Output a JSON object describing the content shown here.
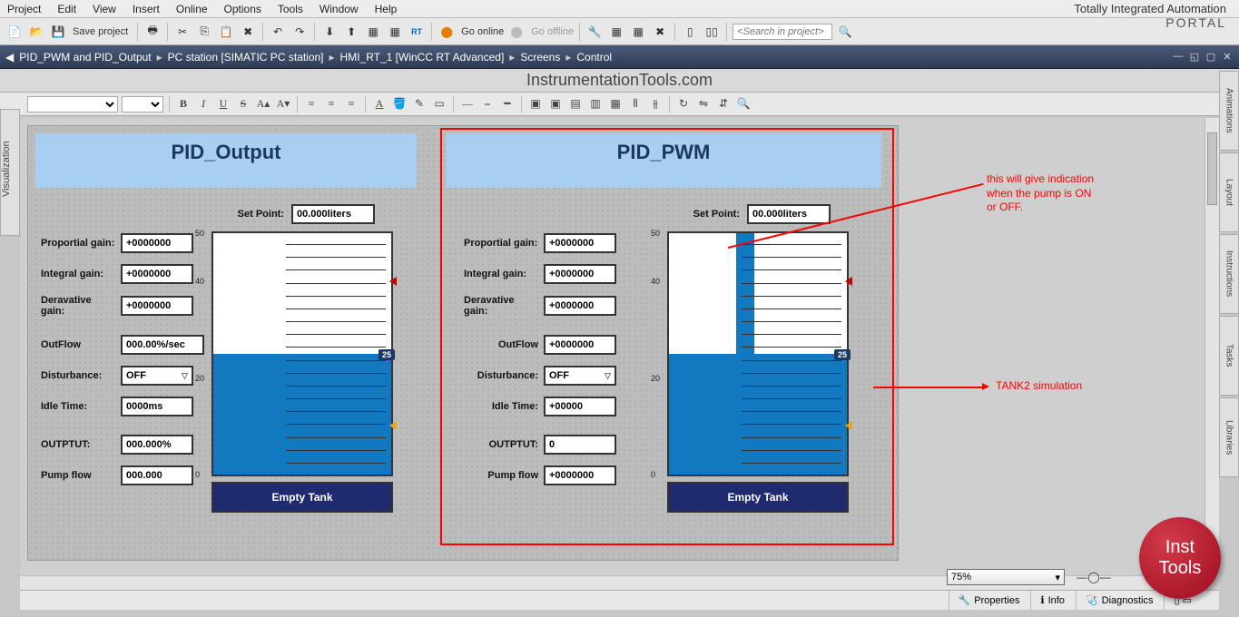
{
  "brand": {
    "line1": "Totally Integrated Automation",
    "line2": "PORTAL"
  },
  "menu": [
    "Project",
    "Edit",
    "View",
    "Insert",
    "Online",
    "Options",
    "Tools",
    "Window",
    "Help"
  ],
  "toolbar": {
    "save_label": "Save project",
    "go_online": "Go online",
    "go_offline": "Go offline",
    "search_placeholder": "<Search in project>"
  },
  "breadcrumb": [
    "PID_PWM and PID_Output",
    "PC station [SIMATIC PC station]",
    "HMI_RT_1 [WinCC RT Advanced]",
    "Screens",
    "Control"
  ],
  "watermark": "InstrumentationTools.com",
  "left_tab": "Visualization",
  "right_tabs": [
    "Animations",
    "Layout",
    "Instructions",
    "Tasks",
    "Libraries"
  ],
  "panels": {
    "output": {
      "title": "PID_Output",
      "setpoint_label": "Set Point:",
      "setpoint_value": "00.000liters",
      "rows": [
        {
          "label": "Proportial gain:",
          "value": "+0000000"
        },
        {
          "label": "Integral gain:",
          "value": "+0000000"
        },
        {
          "label": "Deravative gain:",
          "value": "+0000000"
        }
      ],
      "rows2": [
        {
          "label": "OutFlow",
          "value": "000.00%/sec"
        },
        {
          "label": "Disturbance:",
          "value": "OFF",
          "dropdown": true
        },
        {
          "label": "Idle Time:",
          "value": "0000ms"
        }
      ],
      "rows3": [
        {
          "label": "OUTPTUT:",
          "value": "000.000%"
        },
        {
          "label": "Pump flow",
          "value": "000.000"
        }
      ],
      "scale": {
        "top": "50",
        "mid": "40",
        "low": "20",
        "bottom": "0",
        "badge": "25"
      },
      "empty_btn": "Empty Tank"
    },
    "pwm": {
      "title": "PID_PWM",
      "setpoint_label": "Set Point:",
      "setpoint_value": "00.000liters",
      "rows": [
        {
          "label": "Proportial gain:",
          "value": "+0000000"
        },
        {
          "label": "Integral gain:",
          "value": "+0000000"
        },
        {
          "label": "Deravative gain:",
          "value": "+0000000"
        }
      ],
      "rows2": [
        {
          "label": "OutFlow",
          "value": "+0000000"
        },
        {
          "label": "Disturbance:",
          "value": "OFF",
          "dropdown": true
        },
        {
          "label": "Idle Time:",
          "value": "+00000"
        }
      ],
      "rows3": [
        {
          "label": "OUTPTUT:",
          "value": "0"
        },
        {
          "label": "Pump flow",
          "value": "+0000000"
        }
      ],
      "scale": {
        "top": "50",
        "mid": "40",
        "low": "20",
        "bottom": "0",
        "badge": "25"
      },
      "empty_btn": "Empty Tank"
    }
  },
  "annotations": {
    "a1": "this will give indication\nwhen the pump is ON\nor OFF.",
    "a2": "TANK2 simulation"
  },
  "zoom": "75%",
  "status": {
    "properties": "Properties",
    "info": "Info",
    "diagnostics": "Diagnostics"
  },
  "logo": {
    "l1": "Inst",
    "l2": "Tools"
  }
}
